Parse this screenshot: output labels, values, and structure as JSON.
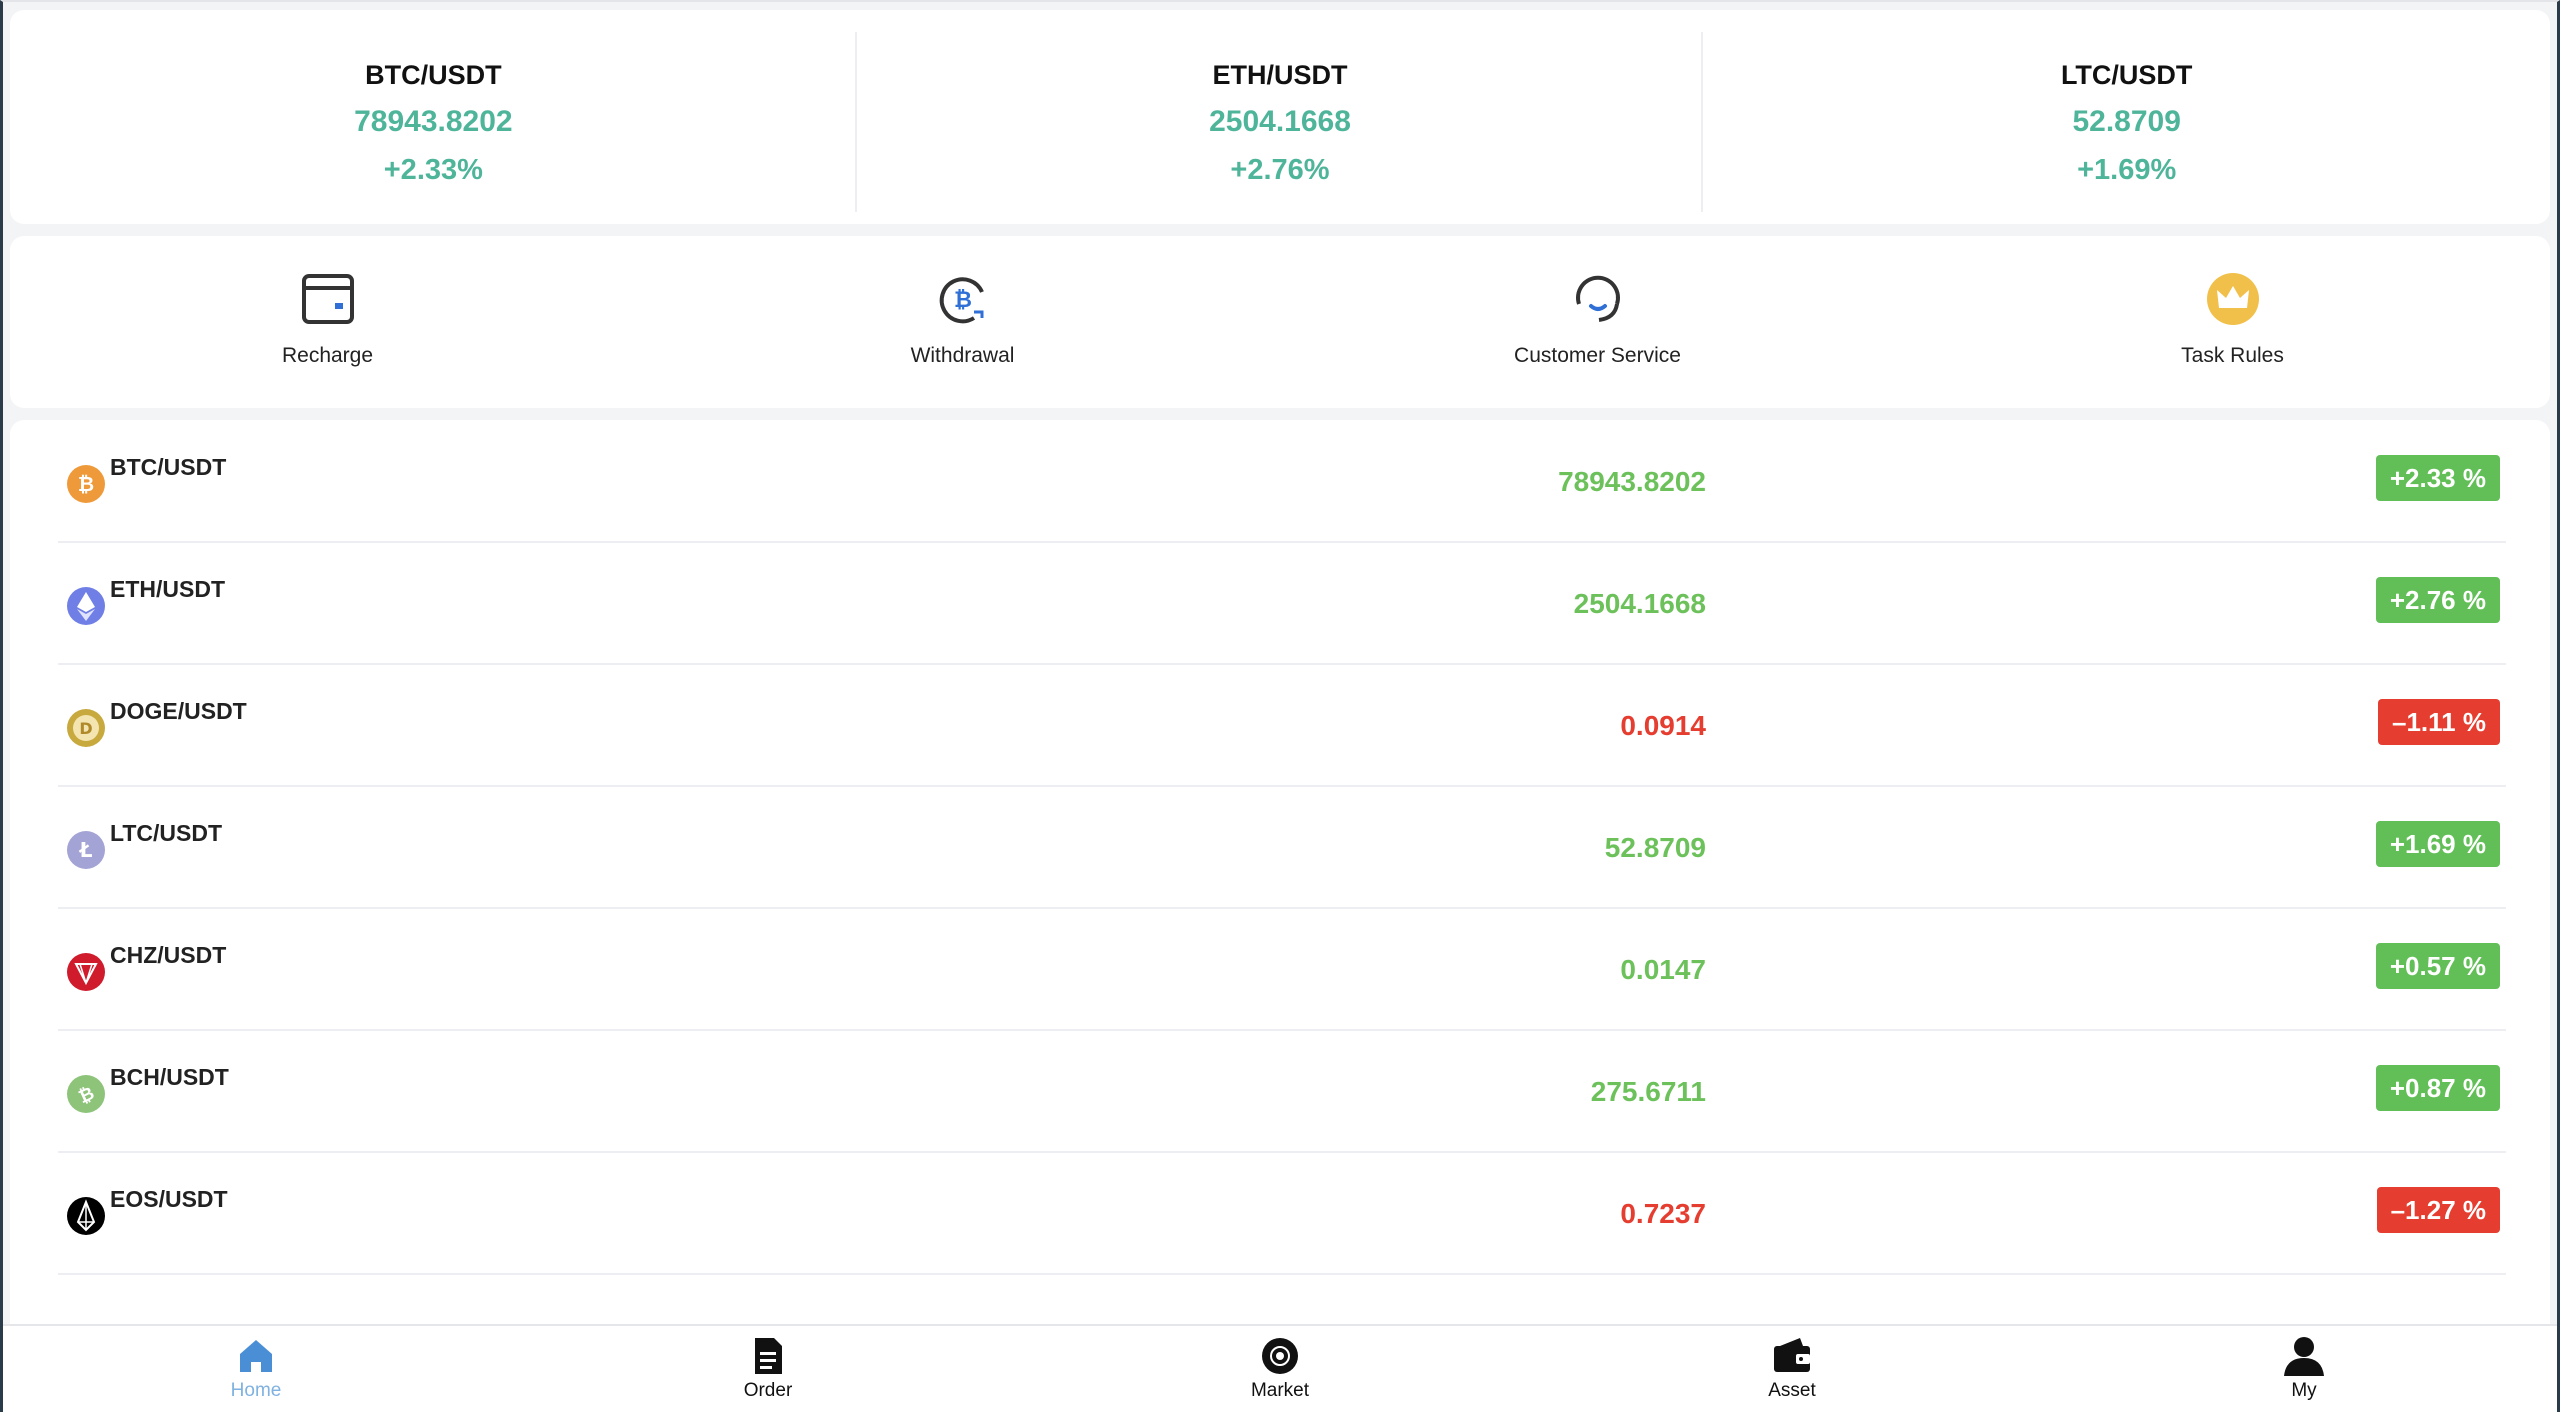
{
  "ticker": [
    {
      "symbol": "BTC/USDT",
      "price": "78943.8202",
      "change": "+2.33%"
    },
    {
      "symbol": "ETH/USDT",
      "price": "2504.1668",
      "change": "+2.76%"
    },
    {
      "symbol": "LTC/USDT",
      "price": "52.8709",
      "change": "+1.69%"
    }
  ],
  "actions": [
    {
      "label": "Recharge",
      "icon": "wallet-card-icon"
    },
    {
      "label": "Withdrawal",
      "icon": "bitcoin-refresh-icon"
    },
    {
      "label": "Customer Service",
      "icon": "headset-icon"
    },
    {
      "label": "Task Rules",
      "icon": "crown-icon"
    }
  ],
  "market": [
    {
      "pair": "BTC/USDT",
      "price": "78943.8202",
      "change": "+2.33 %",
      "direction": "up",
      "icon": "bitcoin-icon",
      "color": "#ef9a3a"
    },
    {
      "pair": "ETH/USDT",
      "price": "2504.1668",
      "change": "+2.76 %",
      "direction": "up",
      "icon": "ethereum-icon",
      "color": "#6f7fe6"
    },
    {
      "pair": "DOGE/USDT",
      "price": "0.0914",
      "change": "–1.11 %",
      "direction": "down",
      "icon": "dogecoin-icon",
      "color": "#c8a93e"
    },
    {
      "pair": "LTC/USDT",
      "price": "52.8709",
      "change": "+1.69 %",
      "direction": "up",
      "icon": "litecoin-icon",
      "color": "#a3a3d6"
    },
    {
      "pair": "CHZ/USDT",
      "price": "0.0147",
      "change": "+0.57 %",
      "direction": "up",
      "icon": "chiliz-icon",
      "color": "#cf1b2b"
    },
    {
      "pair": "BCH/USDT",
      "price": "275.6711",
      "change": "+0.87 %",
      "direction": "up",
      "icon": "bitcoin-cash-icon",
      "color": "#8dc47a"
    },
    {
      "pair": "EOS/USDT",
      "price": "0.7237",
      "change": "–1.27 %",
      "direction": "down",
      "icon": "eos-icon",
      "color": "#000000"
    }
  ],
  "nav": [
    {
      "label": "Home",
      "icon": "home-icon",
      "active": true
    },
    {
      "label": "Order",
      "icon": "document-icon",
      "active": false
    },
    {
      "label": "Market",
      "icon": "market-icon",
      "active": false
    },
    {
      "label": "Asset",
      "icon": "wallet-icon",
      "active": false
    },
    {
      "label": "My",
      "icon": "user-icon",
      "active": false
    }
  ],
  "colors": {
    "up": "#62bf57",
    "down": "#e53d2f",
    "ticker_green": "#4fb59a",
    "nav_active": "#4a8fd6"
  }
}
